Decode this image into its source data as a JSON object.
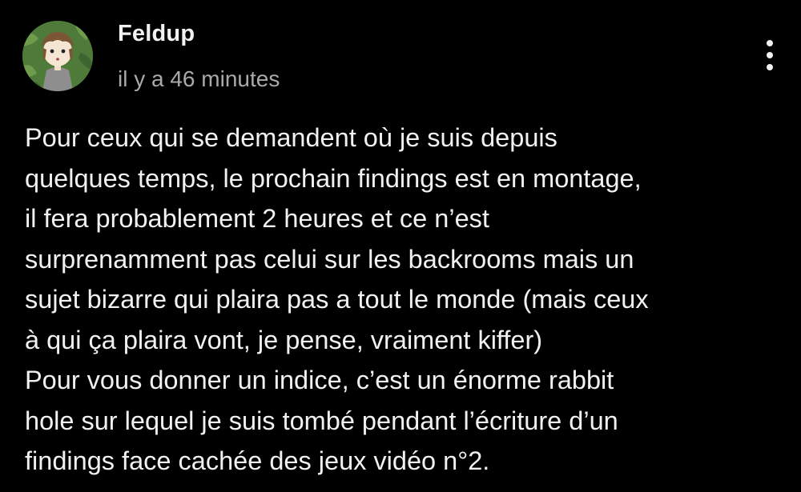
{
  "comment": {
    "author": "Feldup",
    "timestamp": "il y a 46 minutes",
    "avatar_icon": "avatar-character-icon",
    "menu_icon": "more-vertical-icon",
    "lines": [
      "Pour ceux qui se demandent où je suis depuis",
      "quelques temps, le prochain findings est en montage,",
      "il fera probablement 2 heures et ce n’est",
      "surprenamment pas celui sur les backrooms mais un",
      "sujet bizarre qui plaira pas a tout le monde (mais ceux",
      "à qui ça plaira vont, je pense, vraiment kiffer)",
      "Pour vous donner un indice, c’est un énorme rabbit",
      "hole sur lequel je suis tombé pendant l’écriture d’un",
      "findings face cachée des jeux vidéo n°2."
    ]
  },
  "colors": {
    "background": "#000000",
    "text_primary": "#f1f1f1",
    "text_secondary": "#aaaaaa",
    "avatar_bg": "#4f7a3a"
  }
}
